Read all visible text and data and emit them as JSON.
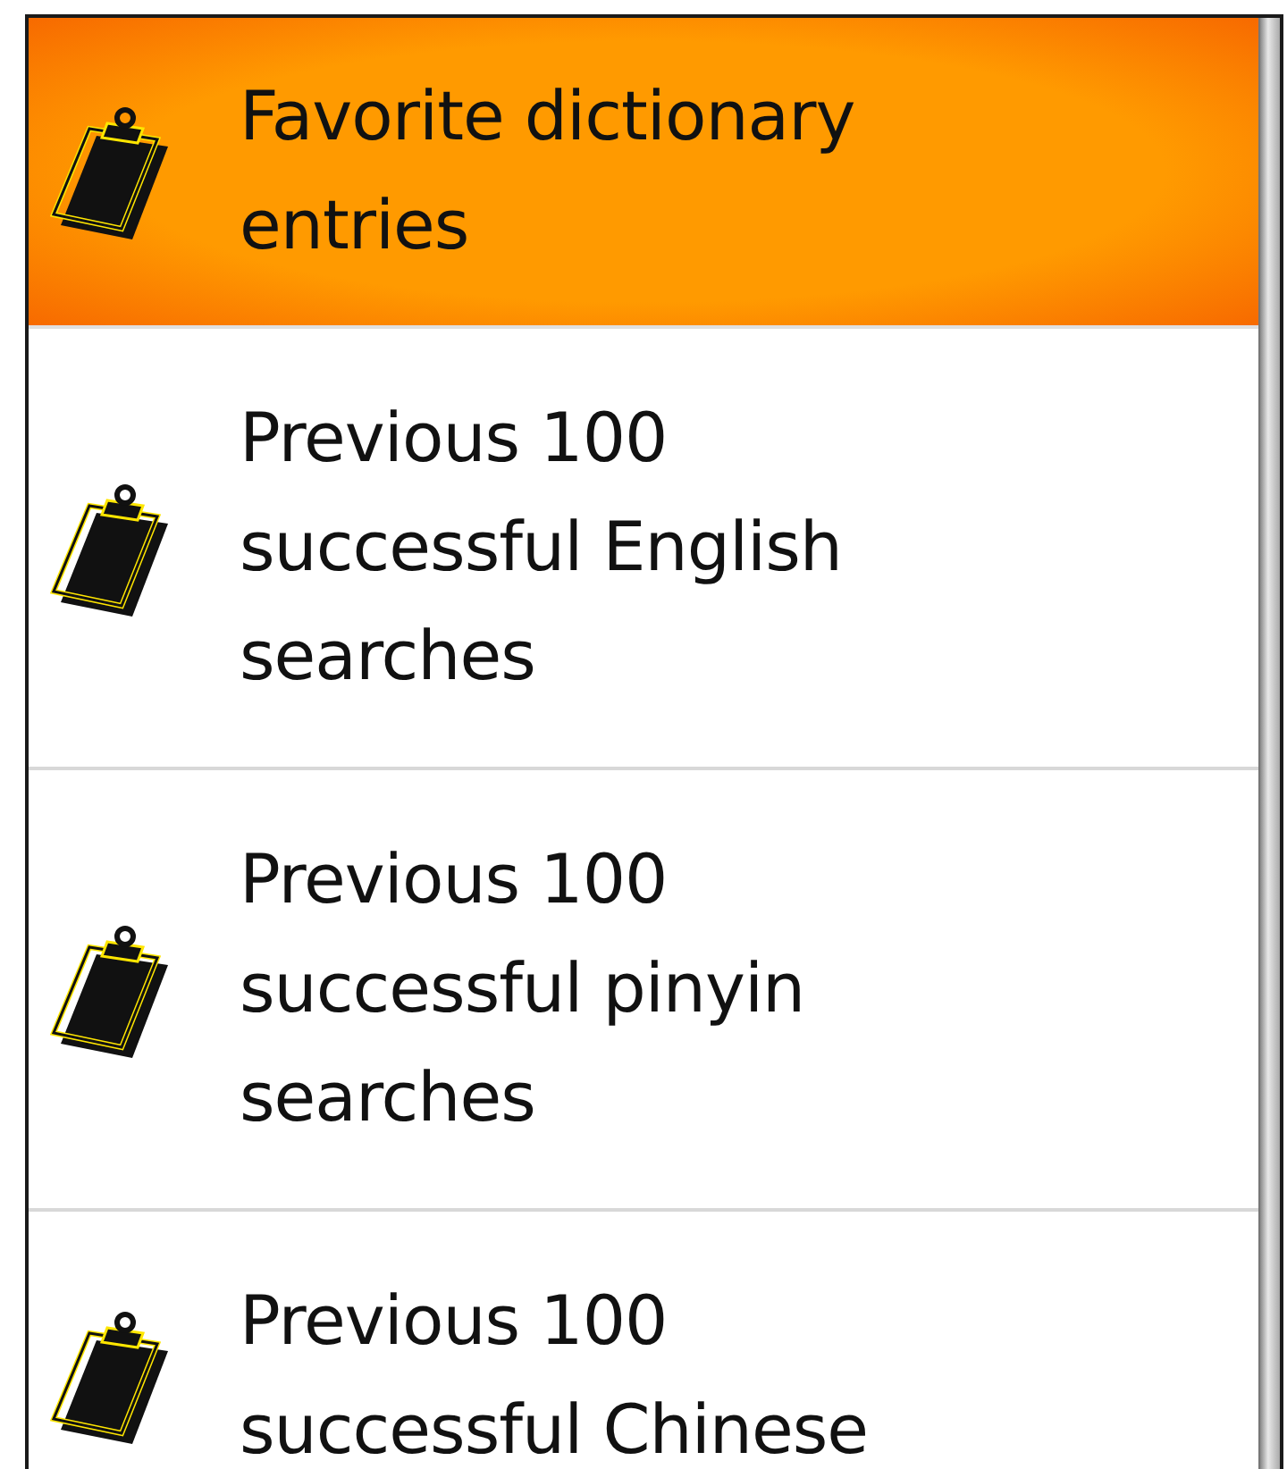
{
  "items": [
    {
      "label": "Favorite dictionary entries",
      "selected": true
    },
    {
      "label": "Previous 100 successful English searches",
      "selected": false
    },
    {
      "label": "Previous 100 successful pinyin searches",
      "selected": false
    },
    {
      "label": "Previous 100 successful Chinese",
      "selected": false
    }
  ]
}
